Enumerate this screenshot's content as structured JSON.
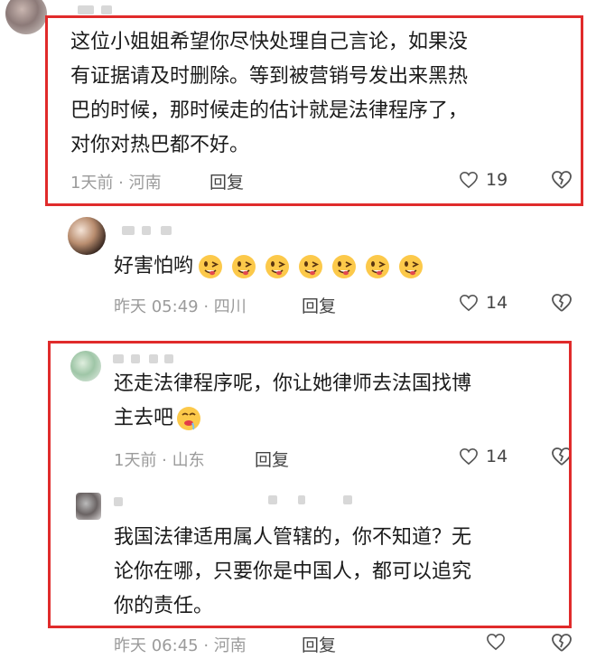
{
  "comments": [
    {
      "text_lines": [
        "这位小姐姐希望你尽快处理自己言论，如果没",
        "有证据请及时删除。等到被营销号发出来黑热",
        "巴的时候，那时候走的估计就是法律程序了，",
        "对你对热巴都不好。"
      ],
      "meta": "1天前 · 河南",
      "reply_label": "回复",
      "likes": "19",
      "highlighted": true
    },
    {
      "text": "好害怕哟",
      "emoji_count": 7,
      "meta": "昨天 05:49 · 四川",
      "reply_label": "回复",
      "likes": "14",
      "highlighted": false
    },
    {
      "text_lines": [
        "还走法律程序呢，你让她律师去法国找博",
        "主去吧"
      ],
      "meta": "1天前 · 山东",
      "reply_label": "回复",
      "likes": "14",
      "highlighted": true
    },
    {
      "text_lines": [
        "我国法律适用属人管辖的，你不知道？无",
        "论你在哪，只要你是中国人，都可以追究",
        "你的责任。"
      ],
      "meta": "昨天 06:45 · 河南",
      "reply_label": "回复",
      "highlighted": true
    }
  ],
  "colors": {
    "highlight_border": "#e02b2b",
    "meta_text": "#9b9b9b"
  },
  "icons": {
    "like": "heart-outline-icon",
    "dislike": "broken-heart-icon",
    "emoji": "teasing-face-emoji",
    "emoji_drool": "drooling-face-emoji"
  }
}
